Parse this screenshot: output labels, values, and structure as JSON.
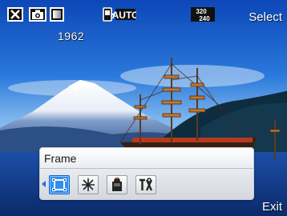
{
  "status_bar": {
    "shots_remaining": "1962",
    "storage_mode": "AUTO",
    "resolution_top": "320",
    "resolution_bottom": "240",
    "icons": [
      "close-mode-icon",
      "camera-mode-icon",
      "color-mode-icon",
      "storage-auto-icon",
      "resolution-icon"
    ]
  },
  "softkeys": {
    "select_label": "Select",
    "exit_label": "Exit"
  },
  "settings_panel": {
    "title": "Frame",
    "options": [
      {
        "name": "frame",
        "icon": "frame-icon",
        "selected": true
      },
      {
        "name": "effect",
        "icon": "sparkle-effect-icon",
        "selected": false
      },
      {
        "name": "scene",
        "icon": "scene-icon",
        "selected": false
      },
      {
        "name": "settings",
        "icon": "tools-icon",
        "selected": false
      }
    ]
  },
  "colors": {
    "selection_blue": "#2f8ff0",
    "sky_blue": "#1f6fd0",
    "text_white": "#ffffff"
  }
}
